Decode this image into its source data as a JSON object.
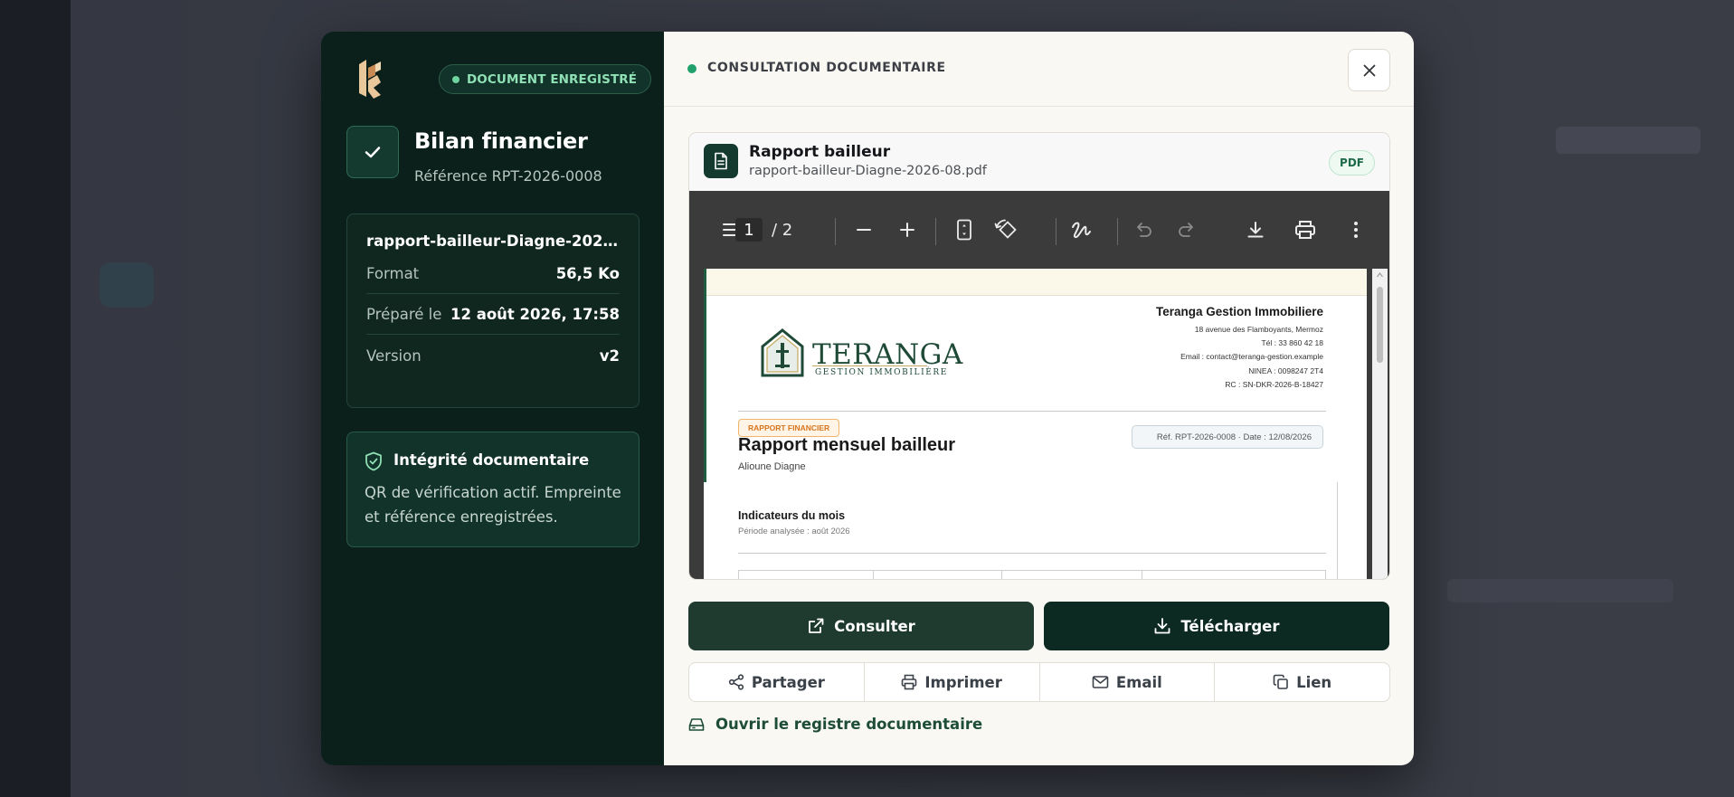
{
  "sidebar": {
    "status_badge": "DOCUMENT ENREGISTRÉ",
    "title": "Bilan financier",
    "reference": "Référence RPT-2026-0008",
    "file_card": {
      "filename": "rapport-bailleur-Diagne-2026...",
      "rows": [
        {
          "label": "Format",
          "value": "56,5 Ko"
        },
        {
          "label": "Préparé le",
          "value": "12 août 2026, 17:58"
        },
        {
          "label": "Version",
          "value": "v2"
        }
      ]
    },
    "integrity": {
      "title": "Intégrité documentaire",
      "text": "QR de vérification actif. Empreinte et référence enregistrées."
    }
  },
  "header": {
    "label": "CONSULTATION DOCUMENTAIRE",
    "status_color": "#22a06b"
  },
  "viewer": {
    "title": "Rapport bailleur",
    "filename": "rapport-bailleur-Diagne-2026-08.pdf",
    "format_badge": "PDF",
    "toolbar": {
      "current_page": "1",
      "page_total": "/ 2"
    },
    "page": {
      "logo_word": "TERANGA",
      "logo_sub": "GESTION IMMOBILIÈRE",
      "company_name": "Teranga Gestion Immobiliere",
      "company_lines": [
        "18 avenue des Flamboyants, Mermoz",
        "Tél : 33 860 42 18",
        "Email : contact@teranga-gestion.example",
        "NINEA : 0098247 2T4",
        "RC : SN-DKR-2026-B-18427"
      ],
      "tag": "RAPPORT FINANCIER",
      "heading": "Rapport mensuel bailleur",
      "owner": "Alioune Diagne",
      "ref_date": "Réf. RPT-2026-0008 · Date : 12/08/2026",
      "section_title": "Indicateurs du mois",
      "period": "Période analysée : août 2026"
    }
  },
  "actions": {
    "consult": "Consulter",
    "download": "Télécharger",
    "share": "Partager",
    "print": "Imprimer",
    "email": "Email",
    "link": "Lien",
    "registry": "Ouvrir le registre documentaire"
  },
  "colors": {
    "sidebar_bg": "#0c201b",
    "accent_green": "#1d4d37",
    "badge_green": "#8fe0b4",
    "download_bg": "#0c2a22",
    "consult_bg": "#1f3a2f"
  }
}
